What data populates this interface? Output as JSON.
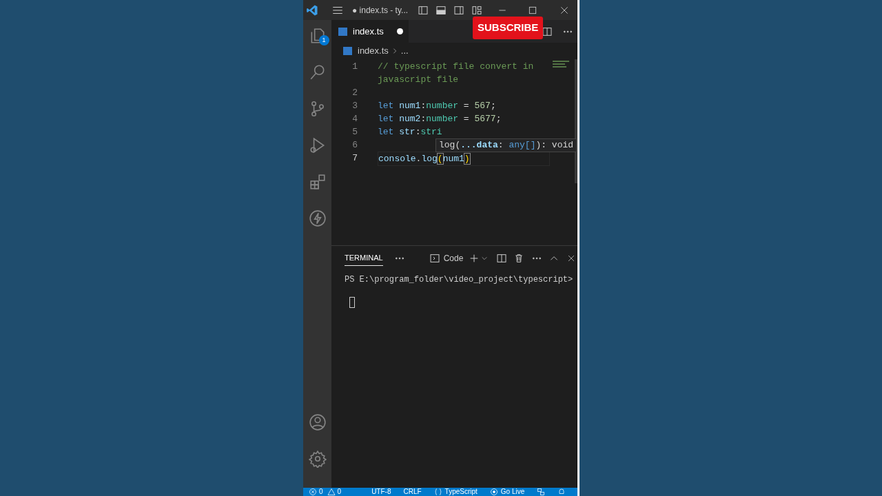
{
  "title_bar": {
    "title": "● index.ts - ty..."
  },
  "activity_bar": {
    "top": [
      {
        "kind": "files",
        "badge": "1"
      },
      {
        "kind": "search"
      },
      {
        "kind": "branch"
      },
      {
        "kind": "run"
      },
      {
        "kind": "extensions"
      },
      {
        "kind": "bolt"
      }
    ],
    "bottom": [
      {
        "kind": "account"
      },
      {
        "kind": "gear"
      }
    ]
  },
  "tabs": [
    {
      "label": "index.ts",
      "selected": true,
      "modified": true
    }
  ],
  "overlay_button": {
    "label": "SUBSCRIBE"
  },
  "breadcrumb": [
    "index.ts",
    "..."
  ],
  "editor": {
    "lines": [
      {
        "number": "1",
        "current": false,
        "tokens": [
          {
            "text": "// typescript file convert in javascript file",
            "kind": "comment"
          }
        ]
      },
      {
        "number": "2",
        "current": false
      },
      {
        "number": "3",
        "current": false,
        "tokens": [
          {
            "text": "let ",
            "kind": "kw"
          },
          {
            "text": "num1",
            "kind": "var"
          },
          {
            "text": ":",
            "kind": "plain"
          },
          {
            "text": "number",
            "kind": "type"
          },
          {
            "text": " = ",
            "kind": "plain"
          },
          {
            "text": "567",
            "kind": "num"
          },
          {
            "text": ";",
            "kind": "plain"
          }
        ]
      },
      {
        "number": "4",
        "current": false,
        "tokens": [
          {
            "text": "let ",
            "kind": "kw"
          },
          {
            "text": "num2",
            "kind": "var"
          },
          {
            "text": ":",
            "kind": "plain"
          },
          {
            "text": "number",
            "kind": "type"
          },
          {
            "text": " = ",
            "kind": "plain"
          },
          {
            "text": "5677",
            "kind": "num"
          },
          {
            "text": ";",
            "kind": "plain"
          }
        ]
      },
      {
        "number": "5",
        "current": false,
        "tokens": [
          {
            "text": "let ",
            "kind": "kw"
          },
          {
            "text": "str",
            "kind": "var"
          },
          {
            "text": ":",
            "kind": "plain"
          },
          {
            "text": "stri",
            "kind": "type"
          }
        ]
      },
      {
        "number": "6",
        "current": false
      },
      {
        "number": "7",
        "current": true,
        "tokens": [
          {
            "text": "console",
            "kind": "var"
          },
          {
            "text": ".",
            "kind": "plain"
          },
          {
            "text": "log",
            "kind": "var"
          },
          {
            "text": "(",
            "kind": "match"
          },
          {
            "text": "num1",
            "kind": "var"
          },
          {
            "text": ")",
            "kind": "match"
          }
        ]
      }
    ]
  },
  "hover": {
    "tokens": [
      {
        "text": "log(",
        "kind": "plain"
      },
      {
        "text": "...data",
        "kind": "param"
      },
      {
        "text": ": ",
        "kind": "plain"
      },
      {
        "text": "any",
        "kind": "kw"
      },
      {
        "text": "[]",
        "kind": "kw"
      },
      {
        "text": "): void",
        "kind": "plain"
      }
    ]
  },
  "panel": {
    "tabs": [
      {
        "label": "TERMINAL",
        "selected": true
      }
    ],
    "shell": "Code",
    "prompt": "PS E:\\program_folder\\video_project\\typescript>"
  },
  "status_bar": {
    "errors": "0",
    "warnings": "0",
    "items": [
      {
        "kind": "text",
        "label": "UTF-8"
      },
      {
        "kind": "text",
        "label": "CRLF"
      },
      {
        "kind": "braces",
        "label": "TypeScript"
      },
      {
        "kind": "live",
        "label": "Go Live"
      }
    ]
  }
}
